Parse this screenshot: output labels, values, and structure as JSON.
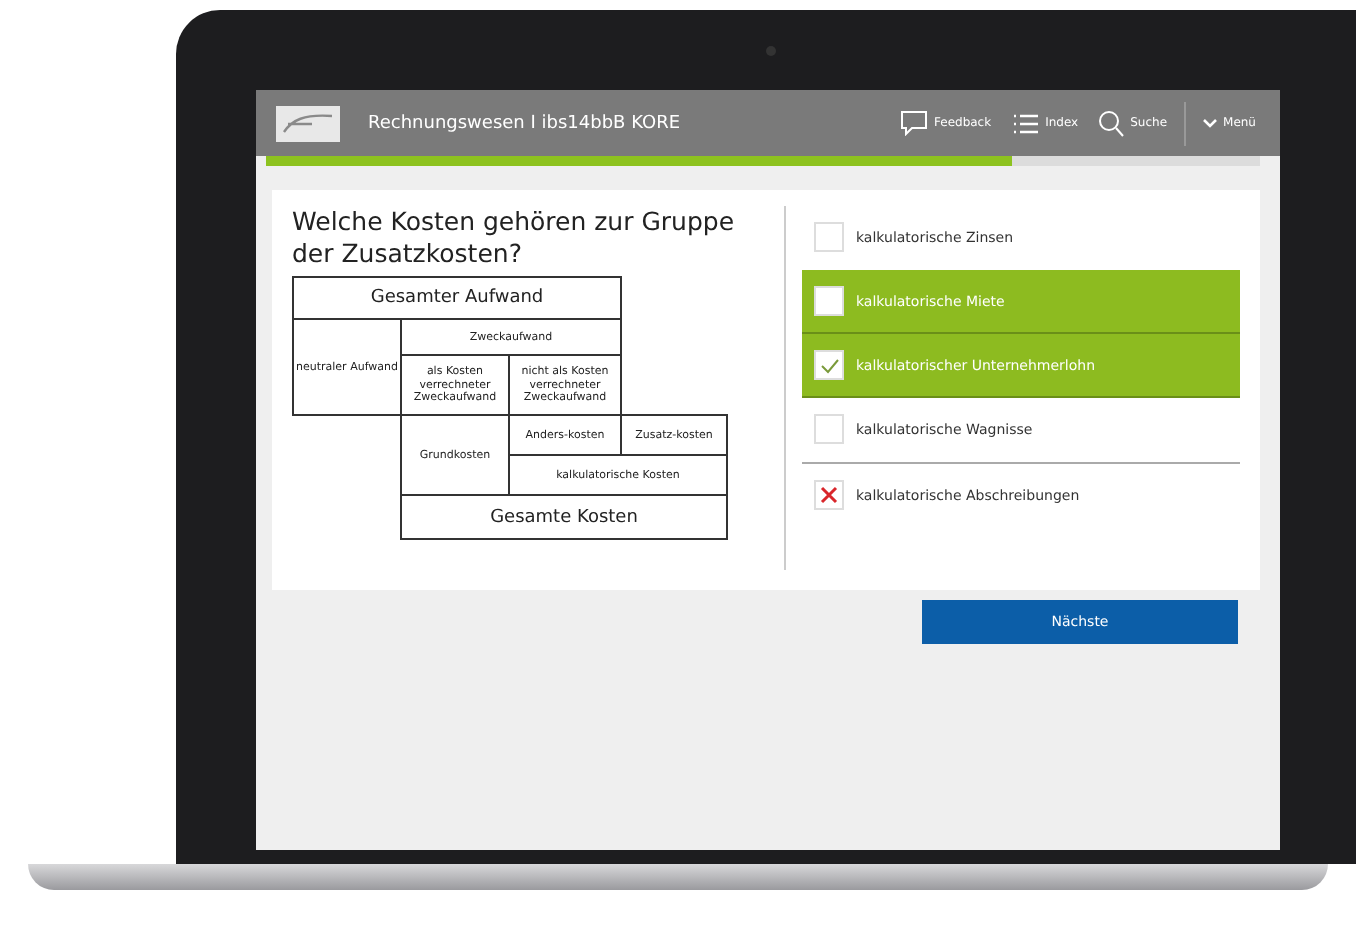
{
  "header": {
    "title": "Rechnungswesen I ibs14bbB KORE",
    "actions": [
      {
        "kind": "feedback",
        "label": "Feedback"
      },
      {
        "kind": "index",
        "label": "Index"
      },
      {
        "kind": "search",
        "label": "Suche"
      },
      {
        "kind": "menu",
        "label": "Menü"
      }
    ]
  },
  "progress": {
    "level": 0.75
  },
  "question": "Welche Kosten gehören zur Gruppe der Zusatzkosten?",
  "diagram": {
    "cells": [
      "Gesamter Aufwand",
      "neutraler Aufwand",
      "Zweckaufwand",
      "als Kosten verrechneter Zweckaufwand",
      "nicht als Kosten verrechneter Zweckaufwand",
      "Grundkosten",
      "Anders-kosten",
      "Zusatz-kosten",
      "kalkulatorische Kosten",
      "Gesamte Kosten"
    ]
  },
  "options": [
    {
      "kind": "checkbox",
      "label": "kalkulatorische Zinsen",
      "selected": false,
      "checked": false
    },
    {
      "kind": "checkbox",
      "label": "kalkulatorische Miete",
      "selected": true,
      "checked": false
    },
    {
      "kind": "checkbox",
      "label": "kalkulatorischer Unternehmerlohn",
      "selected": true,
      "checked": true
    },
    {
      "kind": "checkbox",
      "label": "kalkulatorische Wagnisse",
      "selected": false,
      "checked": false
    },
    {
      "kind": "cross",
      "label": "kalkulatorische Abschreibungen",
      "selected": false
    }
  ],
  "next_button": "Nächste"
}
